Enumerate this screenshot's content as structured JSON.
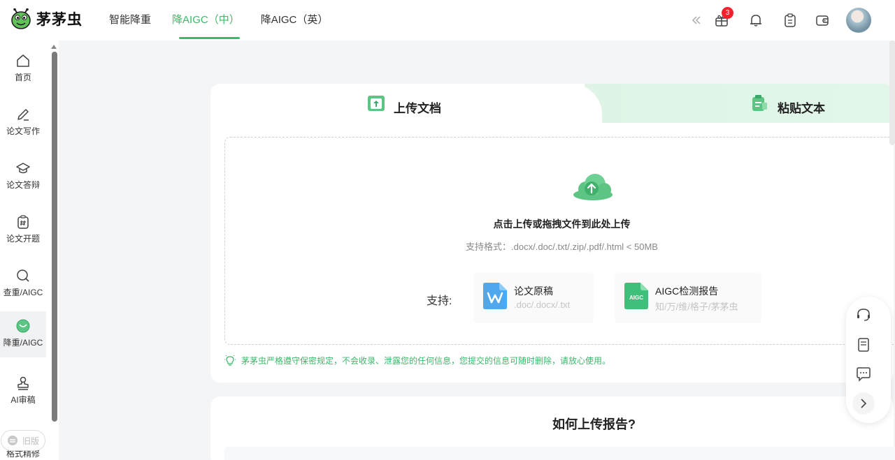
{
  "app": {
    "logo_text": "茅茅虫"
  },
  "header": {
    "nav": [
      {
        "label": "智能降重",
        "active": false
      },
      {
        "label": "降AIGC（中）",
        "active": true
      },
      {
        "label": "降AIGC（英）",
        "active": false
      }
    ],
    "gift_badge_count": "3",
    "accent_color": "#3cb86a"
  },
  "sidebar": {
    "items": [
      {
        "label": "首页",
        "icon": "home-icon"
      },
      {
        "label": "论文写作",
        "icon": "pen-icon"
      },
      {
        "label": "论文答辩",
        "icon": "graduation-cap-icon"
      },
      {
        "label": "论文开题",
        "icon": "hashtag-clipboard-icon"
      },
      {
        "label": "查重/AIGC",
        "icon": "search-icon"
      },
      {
        "label": "降重/AIGC",
        "icon": "reduce-aigc-icon",
        "active": true
      },
      {
        "label": "AI审稿",
        "icon": "stamp-icon"
      },
      {
        "label": "格式精修",
        "icon": "format-icon"
      }
    ],
    "old_version_label": "旧版"
  },
  "upload": {
    "tabs": [
      {
        "label": "上传文档",
        "active": true
      },
      {
        "label": "粘贴文本",
        "active": false
      }
    ],
    "dropzone_title": "点击上传或拖拽文件到此处上传",
    "dropzone_formats": "支持格式：.docx/.doc/.txt/.zip/.pdf/.html < 50MB",
    "support_label": "支持:",
    "support_items": [
      {
        "title": "论文原稿",
        "subtitle": ".doc/.docx/.txt",
        "icon": "wps-icon"
      },
      {
        "title": "AIGC检测报告",
        "subtitle": "知/万/维/格子/茅茅虫",
        "icon": "aigc-icon",
        "icon_text": "AIGC"
      }
    ],
    "privacy_notice": "茅茅虫严格遵守保密规定，不会收录、泄露您的任何信息，您提交的信息可随时删除，请放心使用。"
  },
  "howto": {
    "title": "如何上传报告?"
  }
}
